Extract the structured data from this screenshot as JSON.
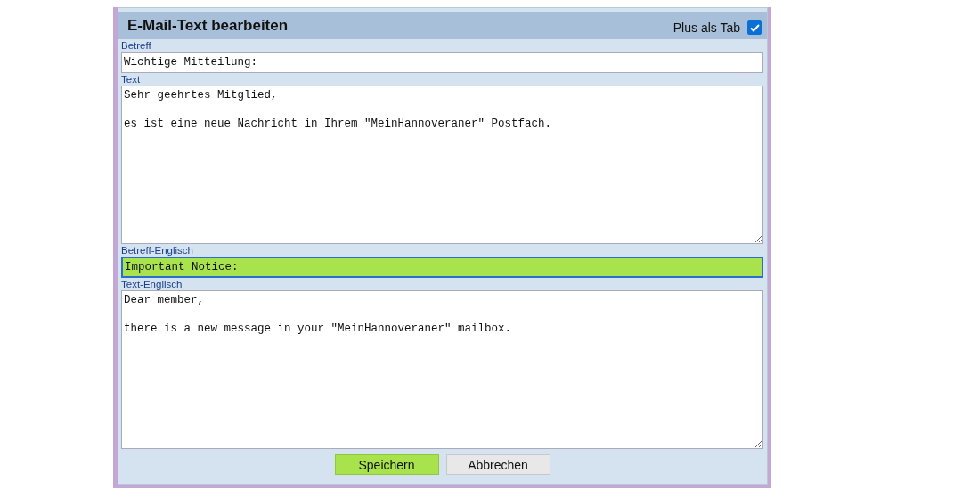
{
  "dialog": {
    "title": "E-Mail-Text bearbeiten",
    "option": {
      "label": "Plus als Tab",
      "checked": true
    }
  },
  "fields": [
    {
      "label": "Betreff",
      "kind": "line",
      "value": "Wichtige Mitteilung:",
      "focused": false
    },
    {
      "label": "Text",
      "kind": "area",
      "value": "Sehr geehrtes Mitglied,\n\nes ist eine neue Nachricht in Ihrem \"MeinHannoveraner\" Postfach.",
      "focused": false
    },
    {
      "label": "Betreff-Englisch",
      "kind": "line",
      "value": "Important Notice:",
      "focused": true
    },
    {
      "label": "Text-Englisch",
      "kind": "area",
      "value": "Dear member,\n\nthere is a new message in your \"MeinHannoveraner\" mailbox.",
      "focused": false
    }
  ],
  "buttons": [
    {
      "label": "Speichern",
      "kind": "primary"
    },
    {
      "label": "Abbrechen",
      "kind": "secondary"
    }
  ]
}
